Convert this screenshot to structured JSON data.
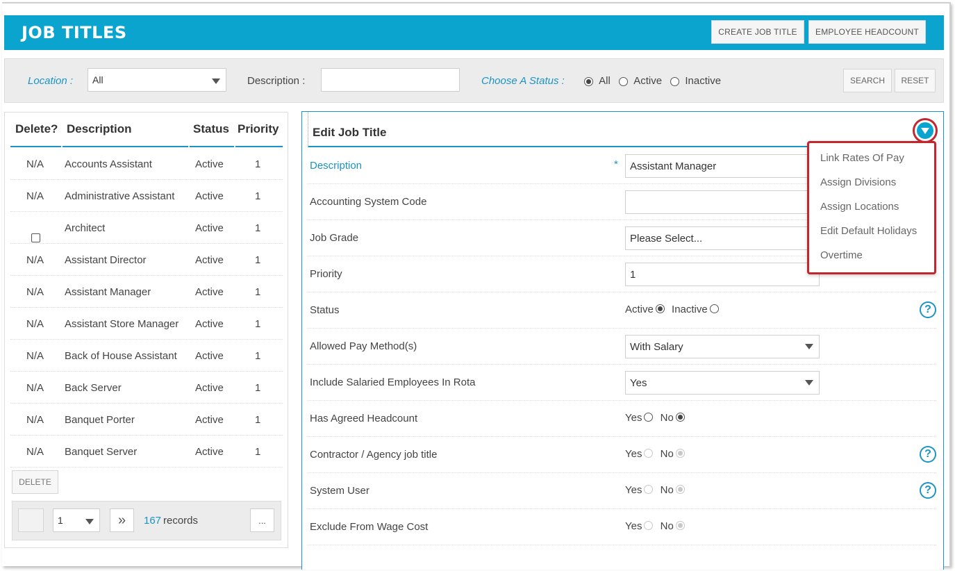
{
  "header": {
    "title": "JOB TITLES",
    "create_button": "CREATE JOB TITLE",
    "headcount_button": "EMPLOYEE HEADCOUNT"
  },
  "filters": {
    "location_label": "Location :",
    "location_value": "All",
    "description_label": "Description :",
    "description_value": "",
    "status_label": "Choose A Status :",
    "status_options": [
      "All",
      "Active",
      "Inactive"
    ],
    "status_selected": "All",
    "search_button": "SEARCH",
    "reset_button": "RESET"
  },
  "list": {
    "columns": [
      "Delete?",
      "Description",
      "Status",
      "Priority"
    ],
    "rows": [
      {
        "delete": "N/A",
        "description": "Accounts Assistant",
        "status": "Active",
        "priority": "1"
      },
      {
        "delete": "N/A",
        "description": "Administrative Assistant",
        "status": "Active",
        "priority": "1"
      },
      {
        "delete": "",
        "description": "Architect",
        "status": "Active",
        "priority": "1"
      },
      {
        "delete": "N/A",
        "description": "Assistant Director",
        "status": "Active",
        "priority": "1"
      },
      {
        "delete": "N/A",
        "description": "Assistant Manager",
        "status": "Active",
        "priority": "1"
      },
      {
        "delete": "N/A",
        "description": "Assistant Store Manager",
        "status": "Active",
        "priority": "1"
      },
      {
        "delete": "N/A",
        "description": "Back of House Assistant",
        "status": "Active",
        "priority": "1"
      },
      {
        "delete": "N/A",
        "description": "Back Server",
        "status": "Active",
        "priority": "1"
      },
      {
        "delete": "N/A",
        "description": "Banquet Porter",
        "status": "Active",
        "priority": "1"
      },
      {
        "delete": "N/A",
        "description": "Banquet Server",
        "status": "Active",
        "priority": "1"
      }
    ],
    "delete_button": "DELETE",
    "pager": {
      "page": "1",
      "next": "»",
      "count": "167",
      "records_label": "records",
      "more": "..."
    }
  },
  "edit": {
    "title": "Edit  Job Title",
    "required_marker": "*",
    "fields": {
      "description": {
        "label": "Description",
        "value": "Assistant Manager"
      },
      "accounting": {
        "label": "Accounting System Code",
        "value": ""
      },
      "job_grade": {
        "label": "Job Grade",
        "value": "Please Select..."
      },
      "priority": {
        "label": "Priority",
        "value": "1"
      },
      "status": {
        "label": "Status",
        "active": "Active",
        "inactive": "Inactive",
        "selected": "Active"
      },
      "pay_method": {
        "label": "Allowed Pay Method(s)",
        "value": "With Salary"
      },
      "salaried": {
        "label": "Include Salaried Employees In Rota",
        "value": "Yes"
      },
      "headcount": {
        "label": "Has Agreed Headcount",
        "yes": "Yes",
        "no": "No",
        "selected": "No"
      },
      "contractor": {
        "label": "Contractor / Agency job title",
        "yes": "Yes",
        "no": "No",
        "selected": "No"
      },
      "system_user": {
        "label": "System User",
        "yes": "Yes",
        "no": "No",
        "selected": "No"
      },
      "exclude_wage": {
        "label": "Exclude From Wage Cost",
        "yes": "Yes",
        "no": "No",
        "selected": "No"
      }
    },
    "help": "?"
  },
  "menu": {
    "items": [
      "Link Rates Of Pay",
      "Assign Divisions",
      "Assign Locations",
      "Edit Default Holidays",
      "Overtime"
    ]
  },
  "colors": {
    "brand": "#0aa4cf",
    "link": "#1a94c4",
    "highlight": "#c1272d"
  }
}
